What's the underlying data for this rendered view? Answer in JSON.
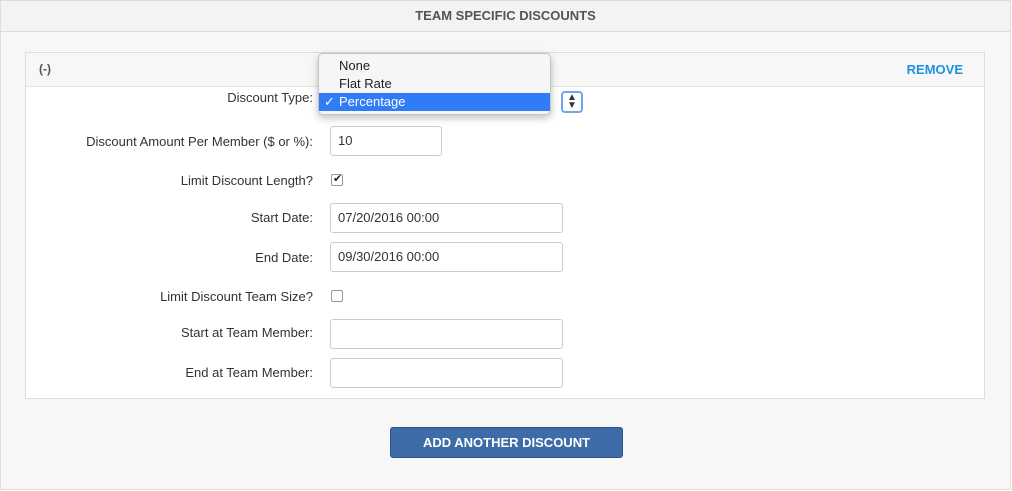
{
  "header": {
    "title": "TEAM SPECIFIC DISCOUNTS"
  },
  "panel": {
    "collapse_label": "(-)",
    "remove_label": "REMOVE",
    "fields": {
      "discount_type": {
        "label": "Discount Type:",
        "options": [
          "None",
          "Flat Rate",
          "Percentage"
        ],
        "selected": "Percentage"
      },
      "amount": {
        "label": "Discount Amount Per Member ($ or %):",
        "value": "10"
      },
      "limit_length": {
        "label": "Limit Discount Length?",
        "checked": true
      },
      "start_date": {
        "label": "Start Date:",
        "value": "07/20/2016 00:00"
      },
      "end_date": {
        "label": "End Date:",
        "value": "09/30/2016 00:00"
      },
      "limit_team_size": {
        "label": "Limit Discount Team Size?",
        "checked": false
      },
      "start_member": {
        "label": "Start at Team Member:",
        "value": ""
      },
      "end_member": {
        "label": "End at Team Member:",
        "value": ""
      }
    }
  },
  "add_button": {
    "label": "ADD ANOTHER DISCOUNT"
  },
  "icons": {
    "check": "✓",
    "checkbox_mark": "✔",
    "select_arrows": "▲▼"
  },
  "colors": {
    "accent": "#1e90e0",
    "button": "#3d6ca8",
    "selected_option": "#2f7cf6"
  }
}
